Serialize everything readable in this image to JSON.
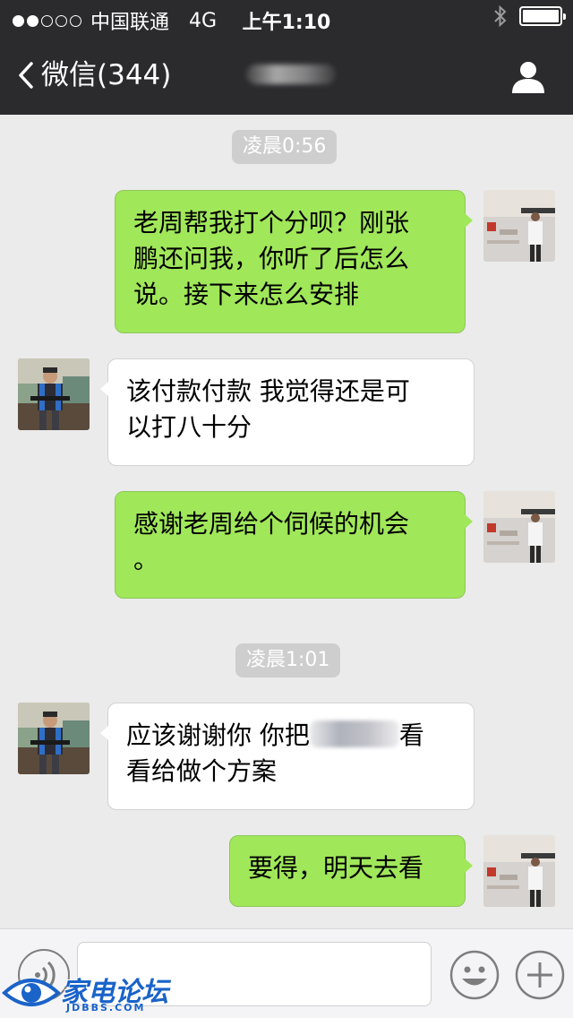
{
  "status_bar": {
    "carrier": "中国联通",
    "network": "4G",
    "time": "上午1:10",
    "signal_strength": 2,
    "signal_max": 5,
    "battery_level": 1.0
  },
  "nav": {
    "back_label": "微信(344)",
    "back_icon": "chevron-left-icon",
    "profile_icon": "person-icon"
  },
  "messages": [
    {
      "type": "timestamp",
      "text": "凌晨0:56"
    },
    {
      "type": "sent",
      "lines": [
        "老周帮我打个分呗？刚张",
        "鹏还问我，你听了后怎么",
        "说。接下来怎么安排"
      ]
    },
    {
      "type": "received",
      "lines": [
        "该付款付款  我觉得还是可",
        "以打八十分"
      ]
    },
    {
      "type": "sent",
      "lines": [
        "感谢老周给个伺候的机会",
        "。"
      ]
    },
    {
      "type": "timestamp",
      "text": "凌晨1:01"
    },
    {
      "type": "received",
      "line1_before": "应该谢谢你  你把",
      "line1_after": "看",
      "line2": "看给做个方案"
    },
    {
      "type": "sent",
      "lines": [
        "要得，明天去看"
      ]
    }
  ],
  "input_bar": {
    "placeholder": "",
    "value": "",
    "voice_icon": "voice-icon",
    "emoji_icon": "emoji-icon",
    "plus_icon": "plus-icon"
  },
  "watermark": {
    "text": "家电论坛",
    "subtext": "JDBBS.COM"
  },
  "colors": {
    "header_bg": "#2b2b2d",
    "chat_bg": "#ebebeb",
    "sent_bubble": "#a0e75a",
    "received_bubble": "#ffffff",
    "timestamp_bg": "#cecece"
  }
}
